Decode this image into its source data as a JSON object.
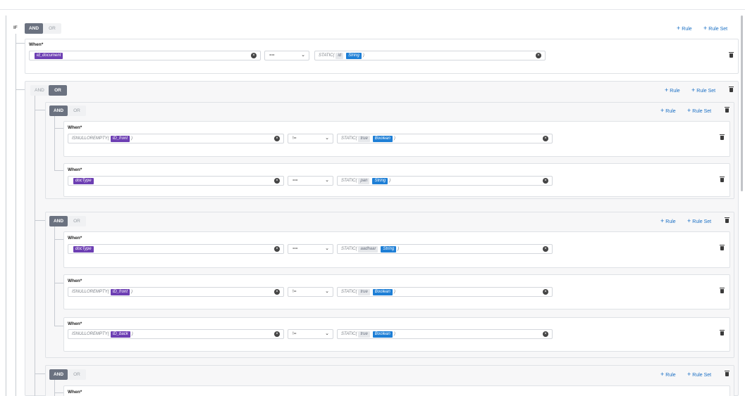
{
  "root": {
    "if_label": "IF",
    "toggle": {
      "and": "AND",
      "or": "OR",
      "active": "AND"
    },
    "actions": {
      "add_rule": "Rule",
      "add_rule_set": "Rule Set"
    }
  },
  "labels": {
    "when": "When*"
  },
  "rules": {
    "r1": {
      "field_tag": "id_document",
      "operator": "==",
      "value_fn": "STATIC(",
      "value_tag": "id",
      "type_tag": "String",
      "value_close": ")"
    },
    "g1": {
      "toggle_active": "OR"
    },
    "g1a": {
      "toggle_active": "AND"
    },
    "r2": {
      "field_fn": "ISNULLOREMPTY(",
      "field_tag": "ID_front",
      "field_close": ")",
      "operator": "!=",
      "value_fn": "STATIC(",
      "value_tag": "true",
      "type_tag": "Boolean",
      "value_close": ")"
    },
    "r3": {
      "field_tag": "docType",
      "operator": "==",
      "value_fn": "STATIC(",
      "value_tag": "pan",
      "type_tag": "String",
      "value_close": ")"
    },
    "g1b": {
      "toggle_active": "AND"
    },
    "r4": {
      "field_tag": "docType",
      "operator": "==",
      "value_fn": "STATIC(",
      "value_tag": "aadhaar",
      "type_tag": "String",
      "value_close": ")"
    },
    "r5": {
      "field_fn": "ISNULLOREMPTY(",
      "field_tag": "ID_front",
      "field_close": ")",
      "operator": "!=",
      "value_fn": "STATIC(",
      "value_tag": "true",
      "type_tag": "Boolean",
      "value_close": ")"
    },
    "r6": {
      "field_fn": "ISNULLOREMPTY(",
      "field_tag": "ID_back",
      "field_close": ")",
      "operator": "!=",
      "value_fn": "STATIC(",
      "value_tag": "true",
      "type_tag": "Boolean",
      "value_close": ")"
    },
    "g1c": {
      "toggle_active": "AND"
    }
  },
  "icons": {
    "close": "close-circle-icon",
    "chevron": "chevron-down-icon",
    "trash": "trash-icon",
    "plus": "plus-icon"
  },
  "colors": {
    "accent": "#1a6fc4",
    "field_tag": "#6d3fb3",
    "type_tag": "#1e7fd6",
    "toggle_active": "#6b7280"
  }
}
